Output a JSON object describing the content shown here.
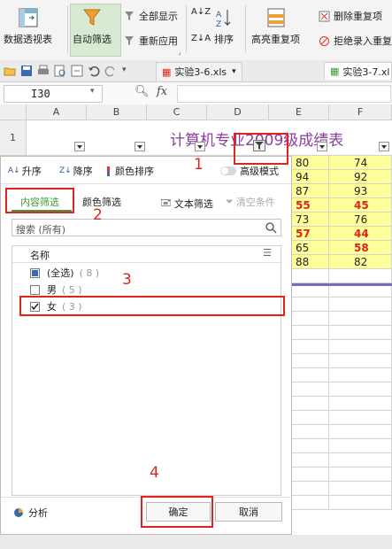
{
  "ribbon": {
    "pivot_label": "数据透视表",
    "autofilter_label": "自动筛选",
    "show_all_label": "全部显示",
    "reapply_label": "重新应用",
    "sort_label": "排序",
    "highlight_dup_label": "高亮重复项",
    "delete_dup_label": "删除重复项",
    "reject_dup_label": "拒绝录入重复"
  },
  "tabs": [
    {
      "label": "实验3-6.xls"
    },
    {
      "label": "实验3-7.xl"
    }
  ],
  "formula_bar": {
    "cell_ref": "I30",
    "fx": "fx"
  },
  "sheet": {
    "columns": [
      "A",
      "B",
      "C",
      "D",
      "E",
      "F"
    ],
    "row1_label": "1",
    "title": "计算机专业2009级成绩表",
    "visible_rows": [
      {
        "e": "80",
        "f": "74",
        "e_red": false,
        "f_red": false
      },
      {
        "e": "94",
        "f": "92",
        "e_red": false,
        "f_red": false
      },
      {
        "e": "87",
        "f": "93",
        "e_red": false,
        "f_red": false
      },
      {
        "e": "55",
        "f": "45",
        "e_red": true,
        "f_red": true
      },
      {
        "e": "73",
        "f": "76",
        "e_red": false,
        "f_red": false
      },
      {
        "e": "57",
        "f": "44",
        "e_red": true,
        "f_red": true
      },
      {
        "e": "65",
        "f": "58",
        "e_red": false,
        "f_red": true
      },
      {
        "e": "88",
        "f": "82",
        "e_red": false,
        "f_red": false
      }
    ]
  },
  "panel": {
    "sort_asc": "升序",
    "sort_desc": "降序",
    "color_sort": "颜色排序",
    "advanced_mode": "高级模式",
    "tab_content": "内容筛选",
    "tab_color": "颜色筛选",
    "text_filter": "文本筛选",
    "clear_filter": "清空条件",
    "search_placeholder": "搜索 (所有)",
    "list_header": "名称",
    "items": [
      {
        "label": "(全选)",
        "count": "( 8 )",
        "state": "partial"
      },
      {
        "label": "男",
        "count": "( 5 )",
        "state": "unchecked"
      },
      {
        "label": "女",
        "count": "( 3 )",
        "state": "checked"
      }
    ],
    "analyze": "分析",
    "ok": "确定",
    "cancel": "取消"
  },
  "annotations": [
    "1",
    "2",
    "3",
    "4"
  ],
  "colors": {
    "accent_green": "#3a9a3a",
    "annotation_red": "#e0231c",
    "title_purple": "#8b3ea0",
    "cell_yellow": "#ffff99"
  }
}
